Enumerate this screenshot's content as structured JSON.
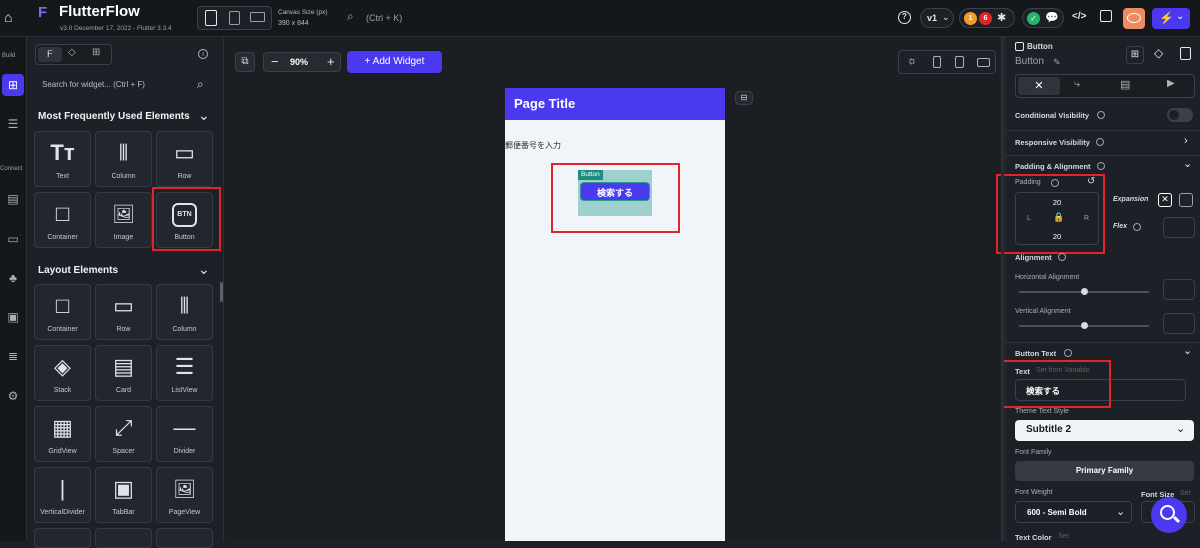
{
  "topbar": {
    "brand": "FlutterFlow",
    "version": "v3.0 December 17, 2022 - Flutter 3.3.4",
    "canvas_size_label": "Canvas Size (px)",
    "canvas_size_value": "390 x 844",
    "search_placeholder": "(Ctrl + K)",
    "version_select": "v1",
    "badge_orange": "1",
    "badge_red": "6"
  },
  "rail": {
    "build_label": "Build",
    "connect_label": "Connect"
  },
  "leftpanel": {
    "search_placeholder": "Search for widget... (Ctrl + F)",
    "section1": "Most Frequently Used Elements",
    "section1_items": [
      {
        "label": "Text",
        "icon": "Tт"
      },
      {
        "label": "Column",
        "icon": "⦀"
      },
      {
        "label": "Row",
        "icon": "▭"
      },
      {
        "label": "Container",
        "icon": "□"
      },
      {
        "label": "Image",
        "icon": "🖼"
      },
      {
        "label": "Button",
        "icon": "BTN"
      }
    ],
    "section2": "Layout Elements",
    "section2_items": [
      {
        "label": "Container",
        "icon": "□"
      },
      {
        "label": "Row",
        "icon": "▭"
      },
      {
        "label": "Column",
        "icon": "⦀"
      },
      {
        "label": "Stack",
        "icon": "◈"
      },
      {
        "label": "Card",
        "icon": "▤"
      },
      {
        "label": "ListView",
        "icon": "☰"
      },
      {
        "label": "GridView",
        "icon": "▦"
      },
      {
        "label": "Spacer",
        "icon": "⤢"
      },
      {
        "label": "Divider",
        "icon": "—"
      },
      {
        "label": "VerticalDivider",
        "icon": "|"
      },
      {
        "label": "TabBar",
        "icon": "▣"
      },
      {
        "label": "PageView",
        "icon": "🖼"
      }
    ]
  },
  "canvas": {
    "zoom": "90%",
    "add_widget": "+ Add Widget",
    "page_title": "Page Title",
    "postal_label": "郵便番号を入力",
    "button_tag": "Button",
    "button_text": "検索する"
  },
  "rightpanel": {
    "widget_type": "Button",
    "widget_name": "Button",
    "conditional_visibility": "Conditional Visibility",
    "responsive_visibility": "Responsive Visibility",
    "padding_alignment": "Padding & Alignment",
    "padding": "Padding",
    "padding_top": "20",
    "padding_bottom": "20",
    "padding_left": "L",
    "padding_right": "R",
    "expansion": "Expansion",
    "flex": "Flex",
    "alignment": "Alignment",
    "horizontal_alignment": "Horizontal Alignment",
    "vertical_alignment": "Vertical Alignment",
    "button_text_section": "Button Text",
    "text_label": "Text",
    "set_from_variable": "Set from Variable",
    "text_value": "検索する",
    "theme_text_style": "Theme Text Style",
    "theme_text_style_value": "Subtitle 2",
    "font_family": "Font Family",
    "font_family_value": "Primary Family",
    "font_weight": "Font Weight",
    "font_weight_value": "600 - Semi Bold",
    "font_size": "Font Size",
    "font_size_set": "Set",
    "text_color": "Text Color",
    "text_color_set": "Set"
  },
  "colors": {
    "accent": "#4b39ef",
    "highlight": "#e0262c",
    "selection": "#9fd1cc"
  }
}
